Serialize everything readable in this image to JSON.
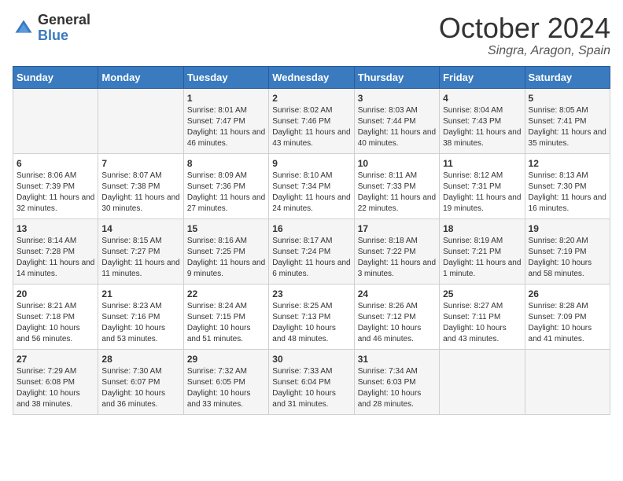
{
  "header": {
    "logo_general": "General",
    "logo_blue": "Blue",
    "month_title": "October 2024",
    "location": "Singra, Aragon, Spain"
  },
  "weekdays": [
    "Sunday",
    "Monday",
    "Tuesday",
    "Wednesday",
    "Thursday",
    "Friday",
    "Saturday"
  ],
  "weeks": [
    [
      {
        "day": "",
        "sunrise": "",
        "sunset": "",
        "daylight": ""
      },
      {
        "day": "",
        "sunrise": "",
        "sunset": "",
        "daylight": ""
      },
      {
        "day": "1",
        "sunrise": "Sunrise: 8:01 AM",
        "sunset": "Sunset: 7:47 PM",
        "daylight": "Daylight: 11 hours and 46 minutes."
      },
      {
        "day": "2",
        "sunrise": "Sunrise: 8:02 AM",
        "sunset": "Sunset: 7:46 PM",
        "daylight": "Daylight: 11 hours and 43 minutes."
      },
      {
        "day": "3",
        "sunrise": "Sunrise: 8:03 AM",
        "sunset": "Sunset: 7:44 PM",
        "daylight": "Daylight: 11 hours and 40 minutes."
      },
      {
        "day": "4",
        "sunrise": "Sunrise: 8:04 AM",
        "sunset": "Sunset: 7:43 PM",
        "daylight": "Daylight: 11 hours and 38 minutes."
      },
      {
        "day": "5",
        "sunrise": "Sunrise: 8:05 AM",
        "sunset": "Sunset: 7:41 PM",
        "daylight": "Daylight: 11 hours and 35 minutes."
      }
    ],
    [
      {
        "day": "6",
        "sunrise": "Sunrise: 8:06 AM",
        "sunset": "Sunset: 7:39 PM",
        "daylight": "Daylight: 11 hours and 32 minutes."
      },
      {
        "day": "7",
        "sunrise": "Sunrise: 8:07 AM",
        "sunset": "Sunset: 7:38 PM",
        "daylight": "Daylight: 11 hours and 30 minutes."
      },
      {
        "day": "8",
        "sunrise": "Sunrise: 8:09 AM",
        "sunset": "Sunset: 7:36 PM",
        "daylight": "Daylight: 11 hours and 27 minutes."
      },
      {
        "day": "9",
        "sunrise": "Sunrise: 8:10 AM",
        "sunset": "Sunset: 7:34 PM",
        "daylight": "Daylight: 11 hours and 24 minutes."
      },
      {
        "day": "10",
        "sunrise": "Sunrise: 8:11 AM",
        "sunset": "Sunset: 7:33 PM",
        "daylight": "Daylight: 11 hours and 22 minutes."
      },
      {
        "day": "11",
        "sunrise": "Sunrise: 8:12 AM",
        "sunset": "Sunset: 7:31 PM",
        "daylight": "Daylight: 11 hours and 19 minutes."
      },
      {
        "day": "12",
        "sunrise": "Sunrise: 8:13 AM",
        "sunset": "Sunset: 7:30 PM",
        "daylight": "Daylight: 11 hours and 16 minutes."
      }
    ],
    [
      {
        "day": "13",
        "sunrise": "Sunrise: 8:14 AM",
        "sunset": "Sunset: 7:28 PM",
        "daylight": "Daylight: 11 hours and 14 minutes."
      },
      {
        "day": "14",
        "sunrise": "Sunrise: 8:15 AM",
        "sunset": "Sunset: 7:27 PM",
        "daylight": "Daylight: 11 hours and 11 minutes."
      },
      {
        "day": "15",
        "sunrise": "Sunrise: 8:16 AM",
        "sunset": "Sunset: 7:25 PM",
        "daylight": "Daylight: 11 hours and 9 minutes."
      },
      {
        "day": "16",
        "sunrise": "Sunrise: 8:17 AM",
        "sunset": "Sunset: 7:24 PM",
        "daylight": "Daylight: 11 hours and 6 minutes."
      },
      {
        "day": "17",
        "sunrise": "Sunrise: 8:18 AM",
        "sunset": "Sunset: 7:22 PM",
        "daylight": "Daylight: 11 hours and 3 minutes."
      },
      {
        "day": "18",
        "sunrise": "Sunrise: 8:19 AM",
        "sunset": "Sunset: 7:21 PM",
        "daylight": "Daylight: 11 hours and 1 minute."
      },
      {
        "day": "19",
        "sunrise": "Sunrise: 8:20 AM",
        "sunset": "Sunset: 7:19 PM",
        "daylight": "Daylight: 10 hours and 58 minutes."
      }
    ],
    [
      {
        "day": "20",
        "sunrise": "Sunrise: 8:21 AM",
        "sunset": "Sunset: 7:18 PM",
        "daylight": "Daylight: 10 hours and 56 minutes."
      },
      {
        "day": "21",
        "sunrise": "Sunrise: 8:23 AM",
        "sunset": "Sunset: 7:16 PM",
        "daylight": "Daylight: 10 hours and 53 minutes."
      },
      {
        "day": "22",
        "sunrise": "Sunrise: 8:24 AM",
        "sunset": "Sunset: 7:15 PM",
        "daylight": "Daylight: 10 hours and 51 minutes."
      },
      {
        "day": "23",
        "sunrise": "Sunrise: 8:25 AM",
        "sunset": "Sunset: 7:13 PM",
        "daylight": "Daylight: 10 hours and 48 minutes."
      },
      {
        "day": "24",
        "sunrise": "Sunrise: 8:26 AM",
        "sunset": "Sunset: 7:12 PM",
        "daylight": "Daylight: 10 hours and 46 minutes."
      },
      {
        "day": "25",
        "sunrise": "Sunrise: 8:27 AM",
        "sunset": "Sunset: 7:11 PM",
        "daylight": "Daylight: 10 hours and 43 minutes."
      },
      {
        "day": "26",
        "sunrise": "Sunrise: 8:28 AM",
        "sunset": "Sunset: 7:09 PM",
        "daylight": "Daylight: 10 hours and 41 minutes."
      }
    ],
    [
      {
        "day": "27",
        "sunrise": "Sunrise: 7:29 AM",
        "sunset": "Sunset: 6:08 PM",
        "daylight": "Daylight: 10 hours and 38 minutes."
      },
      {
        "day": "28",
        "sunrise": "Sunrise: 7:30 AM",
        "sunset": "Sunset: 6:07 PM",
        "daylight": "Daylight: 10 hours and 36 minutes."
      },
      {
        "day": "29",
        "sunrise": "Sunrise: 7:32 AM",
        "sunset": "Sunset: 6:05 PM",
        "daylight": "Daylight: 10 hours and 33 minutes."
      },
      {
        "day": "30",
        "sunrise": "Sunrise: 7:33 AM",
        "sunset": "Sunset: 6:04 PM",
        "daylight": "Daylight: 10 hours and 31 minutes."
      },
      {
        "day": "31",
        "sunrise": "Sunrise: 7:34 AM",
        "sunset": "Sunset: 6:03 PM",
        "daylight": "Daylight: 10 hours and 28 minutes."
      },
      {
        "day": "",
        "sunrise": "",
        "sunset": "",
        "daylight": ""
      },
      {
        "day": "",
        "sunrise": "",
        "sunset": "",
        "daylight": ""
      }
    ]
  ]
}
